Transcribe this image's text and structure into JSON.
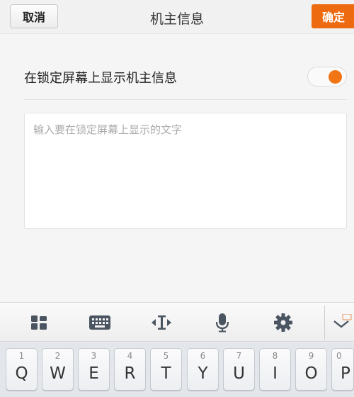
{
  "header": {
    "cancel_label": "取消",
    "title": "机主信息",
    "confirm_label": "确定"
  },
  "setting": {
    "label": "在锁定屏幕上显示机主信息",
    "toggle_on": true,
    "accent_color": "#f27515"
  },
  "owner_text": {
    "value": "",
    "placeholder": "输入要在锁定屏幕上显示的文字"
  },
  "keyboard_toolbar": {
    "icons": [
      "grid-icon",
      "keyboard-icon",
      "cursor-icon",
      "microphone-icon",
      "gear-icon",
      "chevron-down-icon"
    ]
  },
  "keyboard": {
    "keys": [
      {
        "num": "1",
        "letter": "Q"
      },
      {
        "num": "2",
        "letter": "W"
      },
      {
        "num": "3",
        "letter": "E"
      },
      {
        "num": "4",
        "letter": "R"
      },
      {
        "num": "5",
        "letter": "T"
      },
      {
        "num": "6",
        "letter": "Y"
      },
      {
        "num": "7",
        "letter": "U"
      },
      {
        "num": "8",
        "letter": "I"
      },
      {
        "num": "9",
        "letter": "O"
      },
      {
        "num": "0",
        "letter": "P"
      }
    ]
  }
}
